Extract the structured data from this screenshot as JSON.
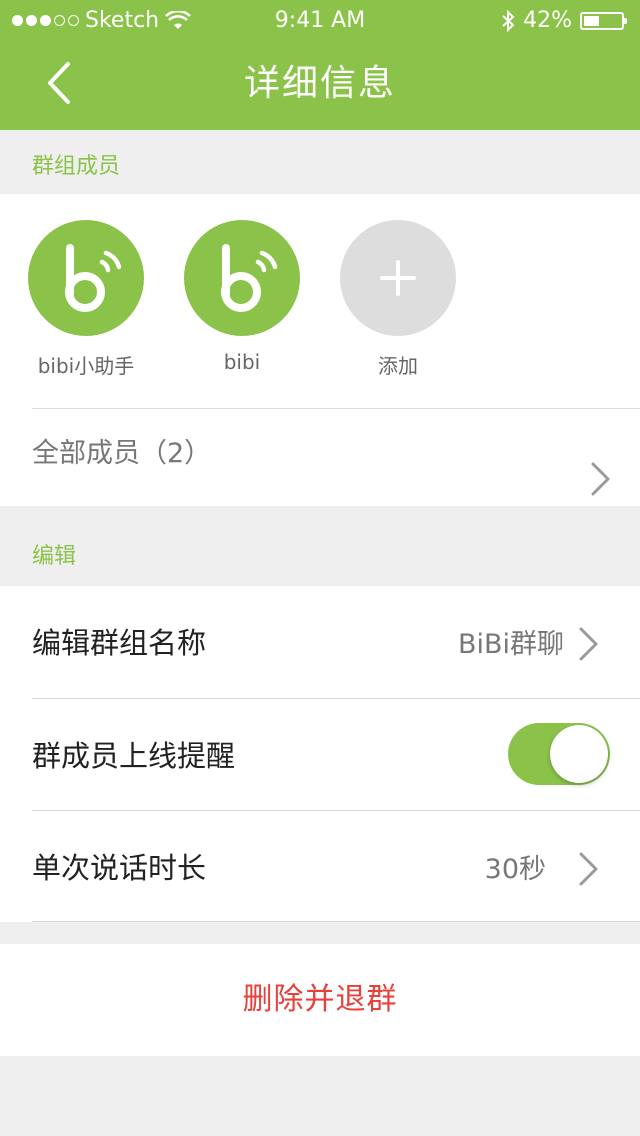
{
  "status_bar": {
    "carrier": "Sketch",
    "time": "9:41 AM",
    "battery": "42%",
    "battery_level": 0.42
  },
  "nav": {
    "title": "详细信息",
    "back_icon": "chevron-left-icon"
  },
  "members_section": {
    "title": "群组成员",
    "members": [
      {
        "name": "bibi小助手",
        "icon": "bibi-logo-icon"
      },
      {
        "name": "bibi",
        "icon": "bibi-logo-icon"
      }
    ],
    "add_label": "添加",
    "all_members_label": "全部成员（2）"
  },
  "edit_section": {
    "title": "编辑",
    "group_name_label": "编辑群组名称",
    "group_name_value": "BiBi群聊",
    "online_reminder_label": "群成员上线提醒",
    "online_reminder_on": true,
    "talk_duration_label": "单次说话时长",
    "talk_duration_value": "30秒"
  },
  "delete_label": "删除并退群",
  "colors": {
    "accent": "#8bc34a",
    "danger": "#e8403a",
    "background": "#efefef"
  }
}
